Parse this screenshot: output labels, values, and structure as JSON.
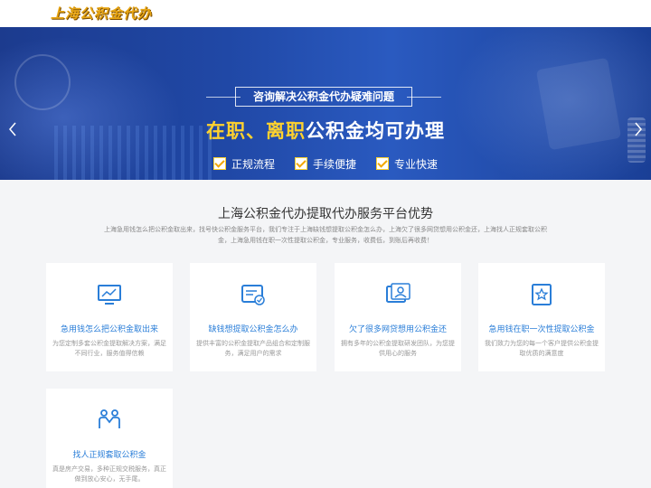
{
  "site": {
    "logo": "上海公积金代办"
  },
  "banner": {
    "subtitle": "咨询解决公积金代办疑难问题",
    "headline_highlight": "在职、离职",
    "headline_rest": "公积金均可办理",
    "features": [
      "正规流程",
      "手续便捷",
      "专业快速"
    ],
    "prev_icon": "chevron-left-icon",
    "next_icon": "chevron-right-icon",
    "slide_count": 2,
    "active_slide": 2,
    "colors": {
      "highlight": "#ffd22e",
      "bg": "#2048a6"
    }
  },
  "advantages": {
    "title": "上海公积金代办提取代办服务平台优势",
    "description": "上海急用钱怎么把公积金取出来，找号快公积金服务平台，我们专注于上海缺钱想提取公积金怎么办，上海欠了很多网贷想用公积金还，上海找人正规套取公积金，上海急用钱在职一次性提取公积金，专业服务，收费低，到账后再收费！",
    "cards": [
      {
        "icon": "chart-icon",
        "title": "急用钱怎么把公积金取出来",
        "desc": "为您定制多套公积金提取解决方案，满足不同行业，服务值得信赖"
      },
      {
        "icon": "card-check-icon",
        "title": "缺钱想提取公积金怎么办",
        "desc": "提供丰富的公积金提取产品组合和定制服务，满足用户的需求"
      },
      {
        "icon": "id-card-icon",
        "title": "欠了很多网贷想用公积金还",
        "desc": "拥有多年的公积金提取研发团队，为您提供用心的服务"
      },
      {
        "icon": "star-badge-icon",
        "title": "急用钱在职一次性提取公积金",
        "desc": "我们致力为您的每一个客户提供公积金提取优质的满意度"
      },
      {
        "icon": "handshake-icon",
        "title": "找人正规套取公积金",
        "desc": "真是房产交易，多种正规交税服务，真正做到放心安心，无手尾。"
      }
    ],
    "colors": {
      "accent": "#2a7ed8"
    }
  }
}
